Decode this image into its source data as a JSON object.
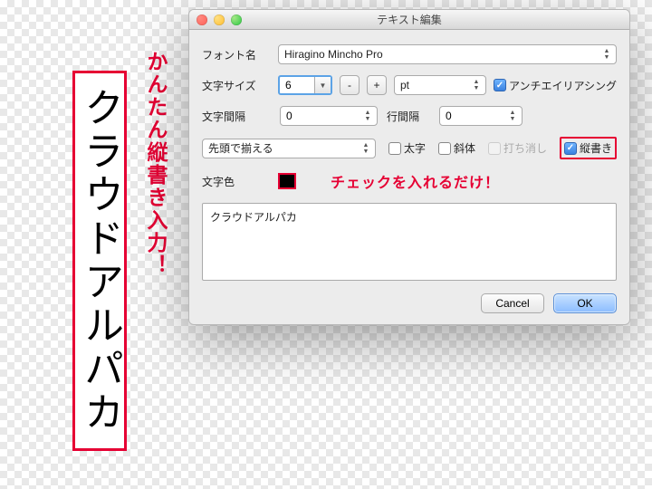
{
  "canvas_text": "クラウドアルパカ",
  "annotation_vertical": "かんたん縦書き入力！",
  "annotation_inline": "チェックを入れるだけ！",
  "dialog": {
    "title": "テキスト編集",
    "font_label": "フォント名",
    "font_value": "Hiragino Mincho Pro",
    "size_label": "文字サイズ",
    "size_value": "6",
    "unit_value": "pt",
    "aa_label": "アンチエイリアシング",
    "char_spacing_label": "文字間隔",
    "char_spacing_value": "0",
    "line_spacing_label": "行間隔",
    "line_spacing_value": "0",
    "align_value": "先頭で揃える",
    "bold_label": "太字",
    "italic_label": "斜体",
    "strike_label": "打ち消し",
    "vertical_label": "縦書き",
    "color_label": "文字色",
    "text_content": "クラウドアルパカ",
    "cancel": "Cancel",
    "ok": "OK",
    "minus": "-",
    "plus": "+"
  }
}
